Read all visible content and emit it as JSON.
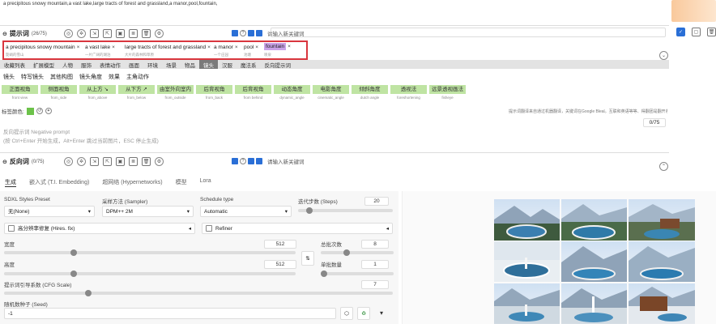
{
  "prompt": {
    "text": "a precipitous snowy mountain,a vast lake,large tracts of forest and grassland,a manor,pool,fountain,"
  },
  "positive": {
    "title": "提示词",
    "count": "(26/75)",
    "input_placeholder": "请输入新关键词",
    "tags": [
      {
        "en": "a precipitous snowy mountain",
        "zh": "陡峭的雪山"
      },
      {
        "en": "a vast lake",
        "zh": "一片广阔的湖泊"
      },
      {
        "en": "large tracts of forest and grassland",
        "zh": "大片的森林和草原"
      },
      {
        "en": "a manor",
        "zh": "一个庄园"
      },
      {
        "en": "pool",
        "zh": "池塘"
      },
      {
        "en": "fountain",
        "zh": "喷泉"
      }
    ]
  },
  "categories": [
    "收藏列表",
    "扩展模型",
    "人物",
    "服饰",
    "表情动作",
    "画面",
    "环境",
    "场景",
    "物品",
    "镜头",
    "汉服",
    "魔法系",
    "反向提示词"
  ],
  "categories_selected": 9,
  "subcategories": [
    "镜头",
    "特写镜头",
    "其他构图",
    "镜头角度",
    "效果",
    "主角动作"
  ],
  "angles": [
    {
      "zh": "正面视角",
      "en": "front view"
    },
    {
      "zh": "侧面视角",
      "en": "from_side"
    },
    {
      "zh": "从上方 ↘",
      "en": "from_above"
    },
    {
      "zh": "从下方 ↗",
      "en": "from_below"
    },
    {
      "zh": "由室外向室内",
      "en": "from_outside"
    },
    {
      "zh": "后背视角",
      "en": "from_back"
    },
    {
      "zh": "后背视角",
      "en": "from behind"
    },
    {
      "zh": "动态角度",
      "en": "dynamic_angle"
    },
    {
      "zh": "电影角度",
      "en": "cinematic_angle"
    },
    {
      "zh": "倾斜角度",
      "en": "dutch angle"
    },
    {
      "zh": "透视法",
      "en": "foreshortening"
    },
    {
      "zh": "远景透视画法",
      "en": "fisheye"
    }
  ],
  "label_color": "标签颜色:",
  "translate_hint": "提示词翻译来自通过机器翻译，关键词在Google Bleal。互联和英语等等、得翻团是翻开系统来翻的！",
  "negative": {
    "placeholder_line1": "反向提示词 Negative prompt",
    "placeholder_line2": "(按 Ctrl+Enter 开始生成，Alt+Enter 跳过当前图片，ESC 停止生成)",
    "counter": "0/75",
    "title": "反向词",
    "count": "(0/75)",
    "input_placeholder": "请输入新关键词"
  },
  "tabs": [
    "生成",
    "嵌入式 (T.I. Embedding)",
    "超网络 (Hypernetworks)",
    "模型",
    "Lora"
  ],
  "settings": {
    "styles_label": "SDXL Styles Preset",
    "styles_value": "无(None)",
    "sampler_label": "采样方法 (Sampler)",
    "sampler_value": "DPM++ 2M",
    "schedule_label": "Schedule type",
    "schedule_value": "Automatic",
    "steps_label": "迭代步数 (Steps)",
    "steps_value": "20",
    "hires_label": "高分辨率修复 (Hires. fix)",
    "refiner_label": "Refiner",
    "width_label": "宽度",
    "width_value": "512",
    "height_label": "高度",
    "height_value": "512",
    "batch_count_label": "总批次数",
    "batch_count_value": "8",
    "batch_size_label": "单批数量",
    "batch_size_value": "1",
    "cfg_label": "提示词引导系数 (CFG Scale)",
    "cfg_value": "7",
    "seed_label": "随机数种子 (Seed)",
    "seed_value": "-1"
  },
  "colors": {
    "accent": "#2a6fd6",
    "tag_green": "#bfe4a3",
    "red_frame": "#d9363e",
    "active_tag": "#c9a2e8"
  }
}
